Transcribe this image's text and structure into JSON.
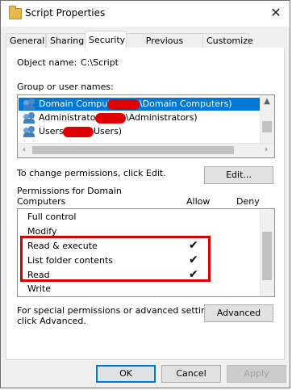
{
  "window": {
    "title": "Script Properties"
  },
  "tabs": [
    {
      "label": "General"
    },
    {
      "label": "Sharing"
    },
    {
      "label": "Security"
    },
    {
      "label": "Previous Versions"
    },
    {
      "label": "Customize"
    }
  ],
  "security": {
    "object_name_label": "Object name:",
    "object_name_value": "C:\\Script",
    "group_label": "Group or user names:",
    "groups": [
      {
        "prefix": "Domain Computers",
        "suffix": "\\Domain Computers)",
        "selected": true
      },
      {
        "prefix": "Administrators",
        "suffix": "\\Administrators)",
        "selected": false
      },
      {
        "prefix": "Users (",
        "suffix": "Users)",
        "selected": false
      }
    ],
    "change_text": "To change permissions, click Edit.",
    "edit_button": "Edit...",
    "permissions_for_line1": "Permissions for Domain",
    "permissions_for_line2": "Computers",
    "allow_header": "Allow",
    "deny_header": "Deny",
    "permissions": [
      {
        "name": "Full control",
        "allow": ""
      },
      {
        "name": "Modify",
        "allow": ""
      },
      {
        "name": "Read & execute",
        "allow": "✔"
      },
      {
        "name": "List folder contents",
        "allow": "✔"
      },
      {
        "name": "Read",
        "allow": "✔"
      },
      {
        "name": "Write",
        "allow": ""
      }
    ],
    "special_line1": "For special permissions or advanced settings,",
    "special_line2": "click Advanced.",
    "advanced_button": "Advanced"
  },
  "footer": {
    "ok": "OK",
    "cancel": "Cancel",
    "apply": "Apply"
  },
  "colors": {
    "selection": "#0078d7",
    "highlight_box": "#d40000",
    "redaction": "#e10000"
  }
}
